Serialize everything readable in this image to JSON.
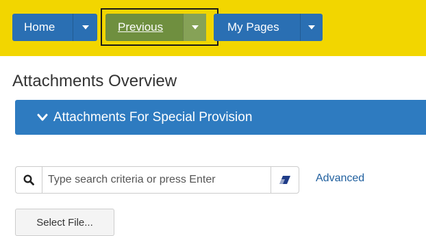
{
  "nav": {
    "home_label": "Home",
    "previous_label": "Previous",
    "mypages_label": "My Pages"
  },
  "page": {
    "title": "Attachments Overview",
    "section_title": "Attachments For Special Provision"
  },
  "search": {
    "placeholder": "Type search criteria or press Enter",
    "value": "",
    "advanced_label": "Advanced"
  },
  "actions": {
    "select_file_label": "Select File..."
  },
  "colors": {
    "topbar": "#f2d600",
    "nav_blue": "#2a6fb3",
    "nav_green": "#6f8f3f",
    "section_blue": "#2e7bc0"
  },
  "icons": {
    "dropdown": "chevron-down-icon",
    "search": "search-icon",
    "clear": "eraser-icon"
  }
}
